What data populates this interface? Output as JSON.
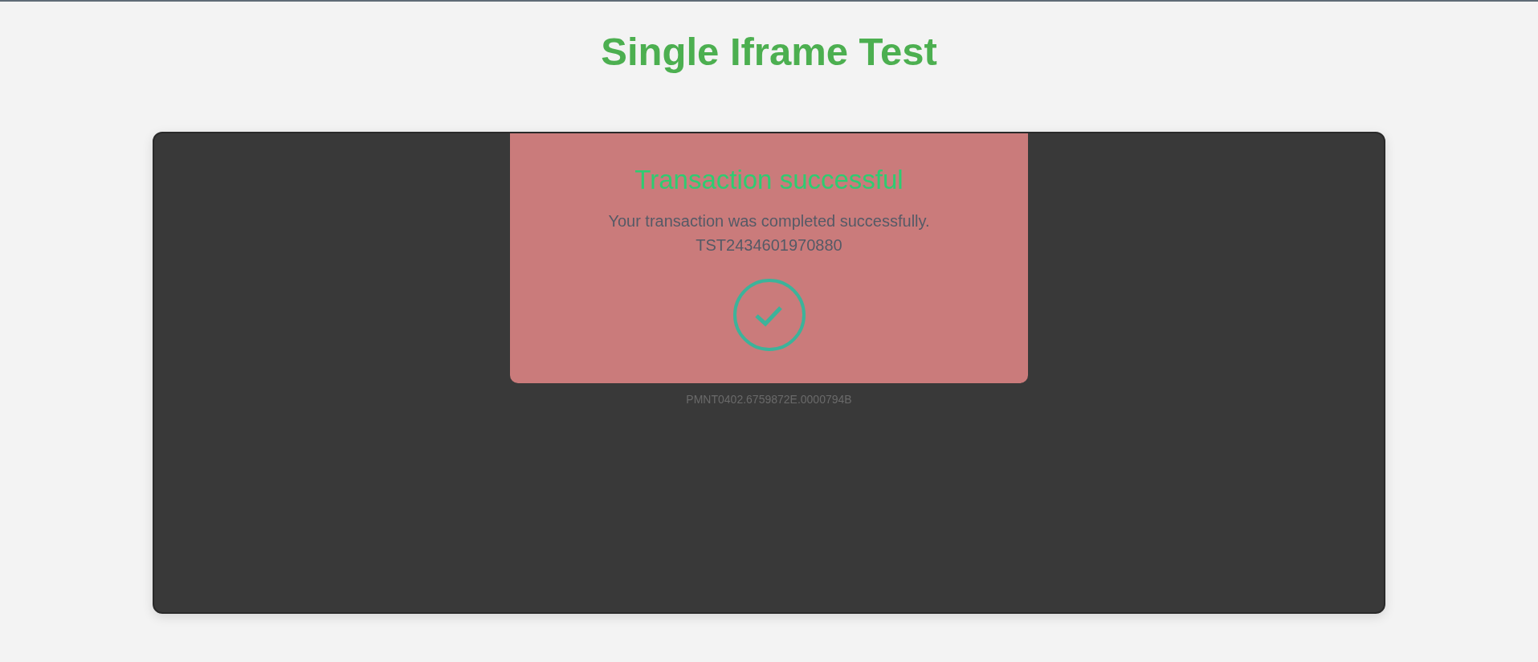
{
  "page": {
    "title": "Single Iframe Test"
  },
  "frame": {
    "card": {
      "title": "Transaction successful",
      "message": "Your transaction was completed successfully.",
      "reference": "TST2434601970880",
      "success": true
    },
    "footer_code": "PMNT0402.6759872E.0000794B"
  }
}
